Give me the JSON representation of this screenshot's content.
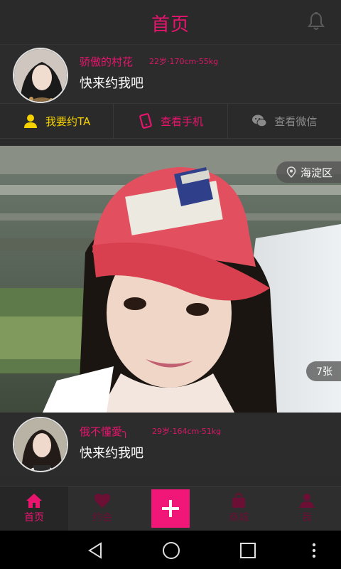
{
  "header": {
    "title": "首页"
  },
  "profiles": [
    {
      "name": "骄傲的村花",
      "meta": "22岁·170cm·55kg",
      "message": "快来约我吧"
    },
    {
      "name": "俄不懂愛╮",
      "meta": "29岁·164cm·51kg",
      "message": "快来约我吧"
    }
  ],
  "actions": [
    {
      "label": "我要约TA",
      "icon": "person-icon",
      "color": "#f5d100"
    },
    {
      "label": "查看手机",
      "icon": "phone-icon",
      "color": "#e8146e"
    },
    {
      "label": "查看微信",
      "icon": "wechat-icon",
      "color": "#8a8a8a"
    }
  ],
  "photo": {
    "location": "海淀区",
    "count": "7张"
  },
  "tabs": [
    {
      "label": "首页",
      "icon": "home-icon",
      "active": true
    },
    {
      "label": "约会",
      "icon": "heart-icon",
      "active": false
    },
    {
      "label": "",
      "icon": "plus-icon",
      "active": false
    },
    {
      "label": "商城",
      "icon": "bag-icon",
      "active": false
    },
    {
      "label": "我",
      "icon": "user-icon",
      "active": false
    }
  ],
  "colors": {
    "accent": "#e8146e",
    "bg": "#2b2b2b"
  }
}
